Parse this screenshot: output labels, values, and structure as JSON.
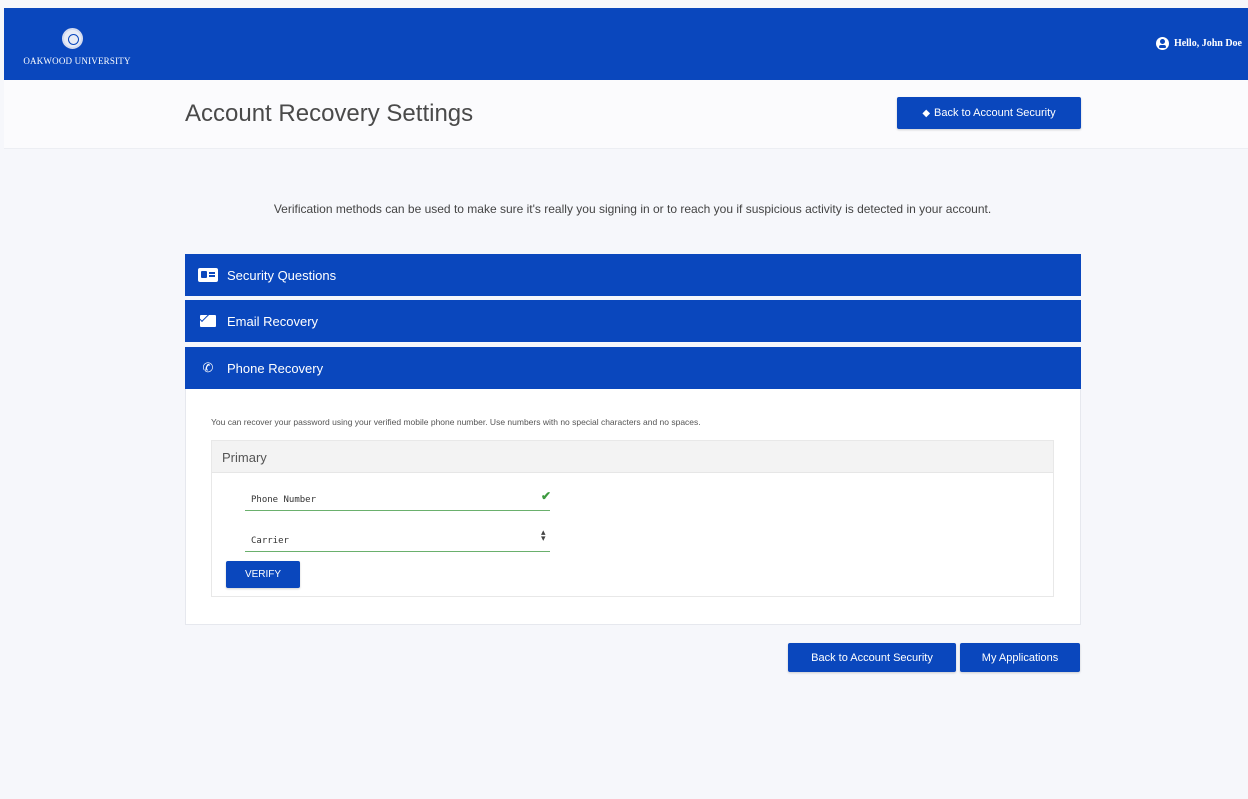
{
  "topbar": {
    "logo_text": "OAKWOOD UNIVERSITY",
    "greeting": "Hello, John Doe"
  },
  "page": {
    "title": "Account Recovery Settings",
    "back_top_label": "Back to Account Security",
    "intro": "Verification methods can be used to make sure it's really you signing in or to reach you if suspicious activity is detected in your account."
  },
  "panels": [
    {
      "label": "Security Questions",
      "icon": "id-card-icon"
    },
    {
      "label": "Email Recovery",
      "icon": "envelope-icon"
    },
    {
      "label": "Phone Recovery",
      "icon": "phone-icon"
    }
  ],
  "phone": {
    "description": "You can recover your password using your verified mobile phone number. Use numbers with no special characters and no spaces.",
    "card_title": "Primary",
    "phone_placeholder": "Phone Number",
    "carrier_placeholder": "Carrier",
    "verify_label": "VERIFY"
  },
  "footer": {
    "back_label": "Back to Account Security",
    "apps_label": "My Applications"
  },
  "colors": {
    "primary": "#0a47bd",
    "valid": "#3c9a3f"
  }
}
